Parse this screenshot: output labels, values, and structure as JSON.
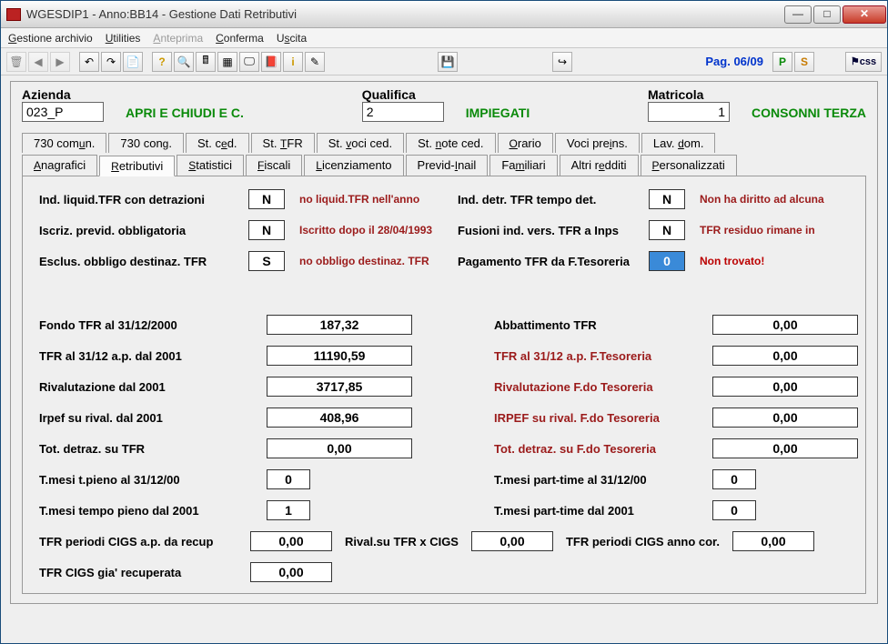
{
  "window": {
    "title": "WGESDIP1  -  Anno:BB14 - Gestione Dati Retributivi"
  },
  "menu": {
    "archivio": "Gestione archivio",
    "utilities": "Utilities",
    "anteprima": "Anteprima",
    "conferma": "Conferma",
    "uscita": "Uscita"
  },
  "toolbar": {
    "page": "Pag. 06/09"
  },
  "header": {
    "azienda_label": "Azienda",
    "azienda_value": "023_P",
    "azienda_name": "APRI E CHIUDI E C.",
    "qualifica_label": "Qualifica",
    "qualifica_value": "2",
    "qualifica_name": "IMPIEGATI",
    "matricola_label": "Matricola",
    "matricola_value": "1",
    "matricola_name": "CONSONNI TERZA"
  },
  "tabs_row1": [
    "730 comun.",
    "730 cong.",
    "St. ced.",
    "St. TFR",
    "St. voci ced.",
    "St. note ced.",
    "Orario",
    "Voci preins.",
    "Lav. dom."
  ],
  "tabs_row2": [
    "Anagrafici",
    "Retributivi",
    "Statistici",
    "Fiscali",
    "Licenziamento",
    "Previd-Inail",
    "Familiari",
    "Altri redditi",
    "Personalizzati"
  ],
  "g1": {
    "r1_l": "Ind. liquid.TFR con detrazioni",
    "r1_v": "N",
    "r1_n": "no liquid.TFR nell'anno",
    "r1b_l": "Ind. detr. TFR tempo det.",
    "r1b_v": "N",
    "r1b_n": "Non ha diritto ad alcuna",
    "r2_l": "Iscriz. previd. obbligatoria",
    "r2_v": "N",
    "r2_n": "Iscritto dopo il 28/04/1993",
    "r2b_l": "Fusioni  ind. vers. TFR a Inps",
    "r2b_v": "N",
    "r2b_n": "TFR residuo rimane in",
    "r3_l": "Esclus. obbligo destinaz. TFR",
    "r3_v": "S",
    "r3_n": "no obbligo destinaz. TFR",
    "r3b_l": "Pagamento TFR da F.Tesoreria",
    "r3b_v": "0",
    "r3b_n": "Non trovato!"
  },
  "g2": {
    "r1_l": "Fondo TFR al 31/12/2000",
    "r1_v": "187,32",
    "r1b_l": "Abbattimento TFR",
    "r1b_v": "0,00",
    "r2_l": "TFR al 31/12 a.p. dal 2001",
    "r2_v": "11190,59",
    "r2b_l": "TFR al 31/12 a.p. F.Tesoreria",
    "r2b_v": "0,00",
    "r3_l": "Rivalutazione dal 2001",
    "r3_v": "3717,85",
    "r3b_l": "Rivalutazione F.do Tesoreria",
    "r3b_v": "0,00",
    "r4_l": "Irpef su rival. dal 2001",
    "r4_v": "408,96",
    "r4b_l": "IRPEF su rival. F.do Tesoreria",
    "r4b_v": "0,00",
    "r5_l": "Tot. detraz. su TFR",
    "r5_v": "0,00",
    "r5b_l": "Tot. detraz. su F.do Tesoreria",
    "r5b_v": "0,00",
    "r6_l": "T.mesi t.pieno al 31/12/00",
    "r6_v": "0",
    "r6b_l": "T.mesi part-time al 31/12/00",
    "r6b_v": "0",
    "r7_l": "T.mesi tempo pieno dal 2001",
    "r7_v": "1",
    "r7b_l": "T.mesi part-time dal 2001",
    "r7b_v": "0"
  },
  "bottom": {
    "c1_l": "TFR periodi CIGS a.p. da recup",
    "c1_v": "0,00",
    "c2_l": "Rival.su TFR x CIGS",
    "c2_v": "0,00",
    "c3_l": "TFR periodi CIGS anno cor.",
    "c3_v": "0,00",
    "c4_l": "TFR CIGS gia' recuperata",
    "c4_v": "0,00"
  }
}
